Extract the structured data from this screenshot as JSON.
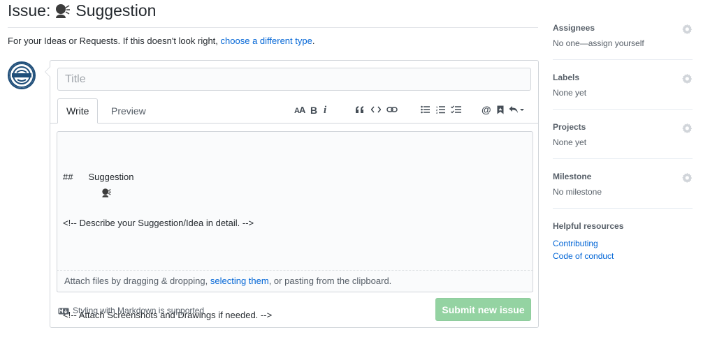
{
  "header": {
    "title_prefix": "Issue:",
    "title_name": "Suggestion"
  },
  "type_line": {
    "text": "For your Ideas or Requests. If this doesn't look right,",
    "link": "choose a different type",
    "suffix": "."
  },
  "form": {
    "title_placeholder": "Title",
    "tabs": {
      "write": "Write",
      "preview": "Preview"
    },
    "toolbar_icons": [
      "text-size-icon",
      "bold-icon",
      "italic-icon",
      "quote-icon",
      "code-icon",
      "link-icon",
      "bullet-list-icon",
      "numbered-list-icon",
      "task-list-icon",
      "mention-icon",
      "saved-reply-icon",
      "reply-icon"
    ],
    "editor": {
      "line1_prefix": "##",
      "line1_text": "Suggestion",
      "line2": "<!-- Describe your Suggestion/Idea in detail. -->",
      "line3": "",
      "line4": "<!-- Attach Screenshots and Drawings if needed. -->"
    },
    "attach": {
      "prefix": "Attach files by dragging & dropping,",
      "link": "selecting them",
      "suffix": ", or pasting from the clipboard."
    },
    "markdown_note": "Styling with Markdown is supported",
    "submit_label": "Submit new issue"
  },
  "sidebar": {
    "assignees": {
      "heading": "Assignees",
      "value": "No one—assign yourself"
    },
    "labels": {
      "heading": "Labels",
      "value": "None yet"
    },
    "projects": {
      "heading": "Projects",
      "value": "None yet"
    },
    "milestone": {
      "heading": "Milestone",
      "value": "No milestone"
    },
    "resources": {
      "heading": "Helpful resources",
      "links": [
        "Contributing",
        "Code of conduct"
      ]
    }
  },
  "colors": {
    "link": "#0366d6",
    "submit_disabled": "#94d3a2",
    "border": "#d1d5da",
    "text_muted": "#586069"
  }
}
